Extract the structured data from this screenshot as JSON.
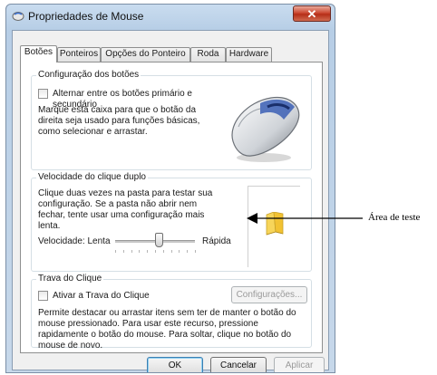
{
  "window": {
    "title": "Propriedades de Mouse",
    "close_glyph": "✕"
  },
  "tabs": [
    {
      "label": "Botões",
      "active": true
    },
    {
      "label": "Ponteiros"
    },
    {
      "label": "Opções do Ponteiro"
    },
    {
      "label": "Roda"
    },
    {
      "label": "Hardware"
    }
  ],
  "buttons_config": {
    "group_label": "Configuração dos botões",
    "checkbox_label": "Alternar entre os botões primário e secundário",
    "description": "Marque esta caixa para que o botão da direita seja usado para funções básicas, como selecionar e arrastar."
  },
  "double_click": {
    "group_label": "Velocidade do clique duplo",
    "description": "Clique duas vezes na pasta para testar sua configuração. Se a pasta não abrir nem fechar, tente usar uma configuração mais lenta.",
    "speed_label": "Velocidade: Lenta",
    "fast_label": "Rápida",
    "slider_position": 0.55
  },
  "click_lock": {
    "group_label": "Trava do Clique",
    "checkbox_label": "Ativar a Trava do Clique",
    "settings_button": "Configurações...",
    "description": "Permite destacar ou arrastar itens sem ter de manter o botão do mouse pressionado. Para usar este recurso, pressione rapidamente o botão do mouse. Para soltar, clique no botão do mouse de novo."
  },
  "footer": {
    "ok": "OK",
    "cancel": "Cancelar",
    "apply": "Aplicar"
  },
  "annotation": {
    "label": "Área de teste"
  },
  "icons": {
    "window": "mouse-icon",
    "mouse_illustration": "mouse-icon",
    "test_area": "folder-icon"
  }
}
